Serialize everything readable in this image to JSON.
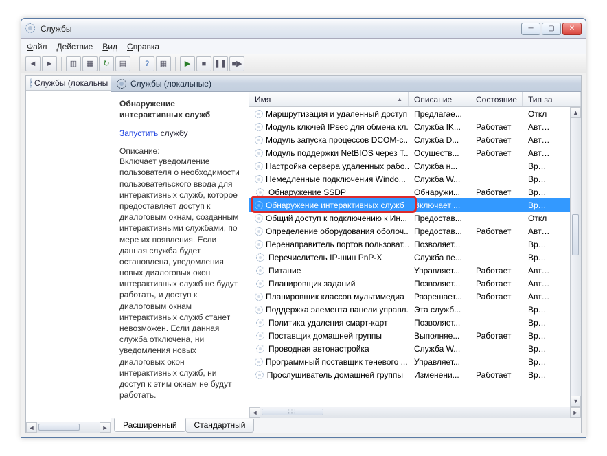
{
  "window": {
    "title": "Службы"
  },
  "menus": {
    "file": "Файл",
    "action": "Действие",
    "view": "Вид",
    "help": "Справка"
  },
  "tree": {
    "root": "Службы (локальны"
  },
  "pane": {
    "header": "Службы (локальные)"
  },
  "detail": {
    "name": "Обнаружение интерактивных служб",
    "start_link": "Запустить",
    "start_suffix": " службу",
    "desc_label": "Описание:",
    "desc_text": "Включает уведомление пользователя о необходимости пользовательского ввода для интерактивных служб, которое предоставляет доступ к диалоговым окнам, созданным интерактивными службами, по мере их появления. Если данная служба будет остановлена, уведомления новых диалоговых окон интерактивных служб не будут работать, и доступ к диалоговым окнам интерактивных служб станет невозможен. Если данная служба отключена, ни уведомления новых диалоговых окон интерактивных служб, ни доступ к этим окнам не будут работать."
  },
  "columns": {
    "name": "Имя",
    "desc": "Описание",
    "state": "Состояние",
    "type": "Тип за"
  },
  "tabs": {
    "ext": "Расширенный",
    "std": "Стандартный"
  },
  "selected_index": 7,
  "services": [
    {
      "name": "Маршрутизация и удаленный доступ",
      "desc": "Предлагае...",
      "state": "",
      "type": "Откл"
    },
    {
      "name": "Модуль ключей IPsec для обмена кл...",
      "desc": "Служба IK...",
      "state": "Работает",
      "type": "Автом"
    },
    {
      "name": "Модуль запуска процессов DCOM-с...",
      "desc": "Служба D...",
      "state": "Работает",
      "type": "Автом"
    },
    {
      "name": "Модуль поддержки NetBIOS через T...",
      "desc": "Осуществ...",
      "state": "Работает",
      "type": "Автом"
    },
    {
      "name": "Настройка сервера удаленных рабо...",
      "desc": "Служба н...",
      "state": "",
      "type": "Вручн"
    },
    {
      "name": "Немедленные подключения Windo...",
      "desc": "Служба W...",
      "state": "",
      "type": "Вручн"
    },
    {
      "name": "Обнаружение SSDP",
      "desc": "Обнаружи...",
      "state": "Работает",
      "type": "Вручн"
    },
    {
      "name": "Обнаружение интерактивных служб",
      "desc": "Включает ...",
      "state": "",
      "type": "Вручн"
    },
    {
      "name": "Общий доступ к подключению к Ин...",
      "desc": "Предостав...",
      "state": "",
      "type": "Откл"
    },
    {
      "name": "Определение оборудования оболоч...",
      "desc": "Предостав...",
      "state": "Работает",
      "type": "Автом"
    },
    {
      "name": "Перенаправитель портов пользоват...",
      "desc": "Позволяет...",
      "state": "",
      "type": "Вручн"
    },
    {
      "name": "Перечислитель IP-шин PnP-X",
      "desc": "Служба пе...",
      "state": "",
      "type": "Вручн"
    },
    {
      "name": "Питание",
      "desc": "Управляет...",
      "state": "Работает",
      "type": "Автом"
    },
    {
      "name": "Планировщик заданий",
      "desc": "Позволяет...",
      "state": "Работает",
      "type": "Автом"
    },
    {
      "name": "Планировщик классов мультимедиа",
      "desc": "Разрешает...",
      "state": "Работает",
      "type": "Автом"
    },
    {
      "name": "Поддержка элемента панели управл...",
      "desc": "Эта служб...",
      "state": "",
      "type": "Вручн"
    },
    {
      "name": "Политика удаления смарт-карт",
      "desc": "Позволяет...",
      "state": "",
      "type": "Вручн"
    },
    {
      "name": "Поставщик домашней группы",
      "desc": "Выполняе...",
      "state": "Работает",
      "type": "Вручн"
    },
    {
      "name": "Проводная автонастройка",
      "desc": "Служба W...",
      "state": "",
      "type": "Вручн"
    },
    {
      "name": "Программный поставщик теневого ...",
      "desc": "Управляет...",
      "state": "",
      "type": "Вручн"
    },
    {
      "name": "Прослушиватель домашней группы",
      "desc": "Изменени...",
      "state": "Работает",
      "type": "Вручн"
    }
  ]
}
